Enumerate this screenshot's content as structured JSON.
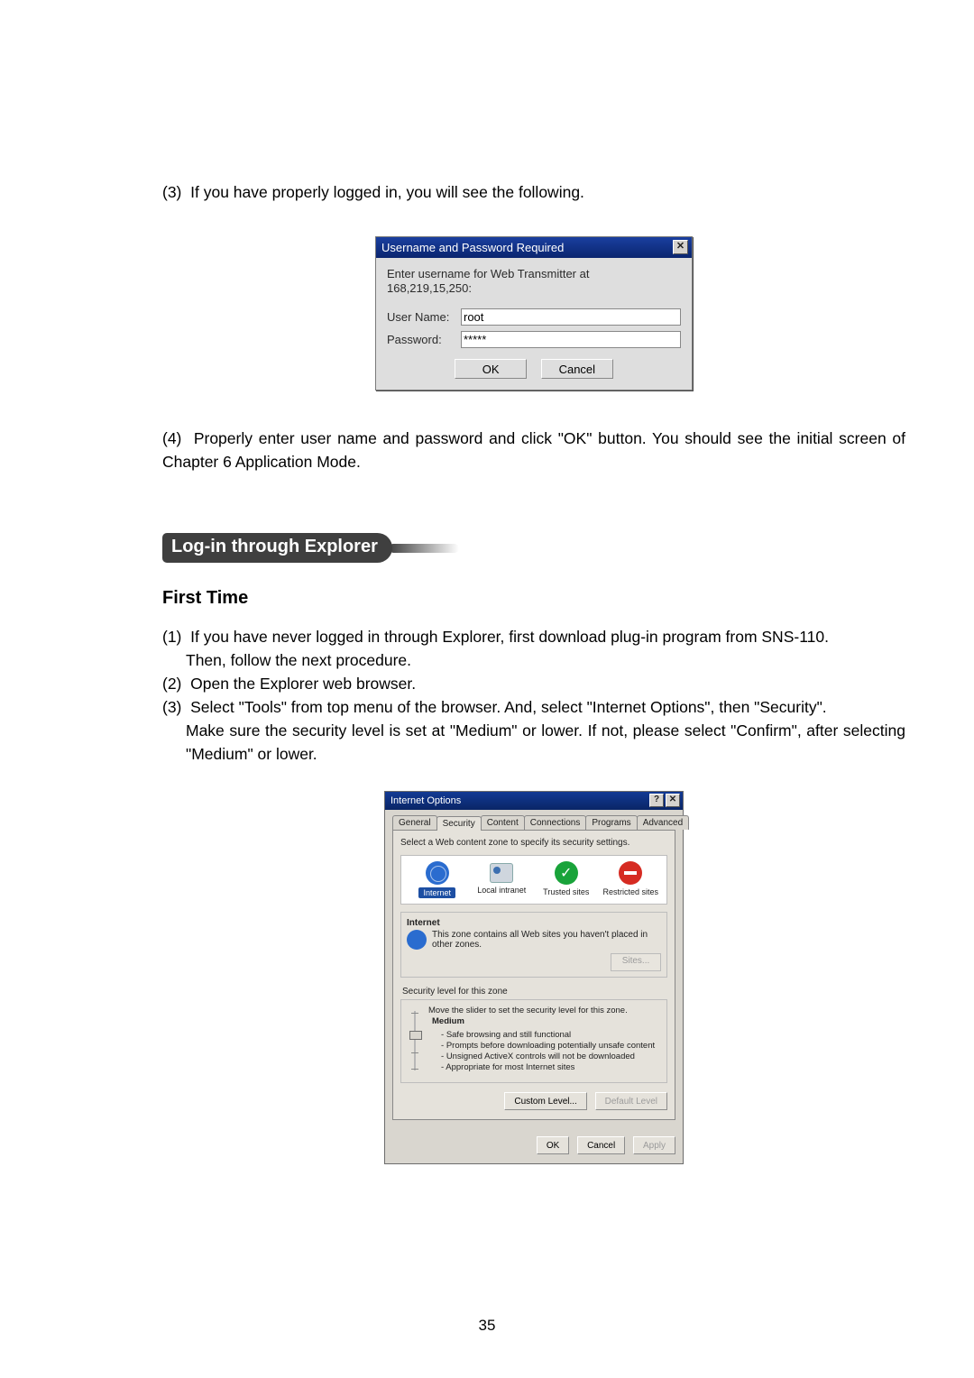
{
  "page_number": "35",
  "top_paragraph": {
    "n": "(3)",
    "text": "If you have properly logged in, you will see the following."
  },
  "login_dialog": {
    "title": "Username and Password Required",
    "message_l1": "Enter username for Web Transmitter at",
    "message_l2": "168,219,15,250:",
    "username_label": "User Name:",
    "username_value": "root",
    "password_label": "Password:",
    "password_value": "*****",
    "ok": "OK",
    "cancel": "Cancel"
  },
  "mid_paragraph": {
    "n": "(4)",
    "text": "Properly enter user name and password and click \"OK\" button.  You should see the initial screen of Chapter 6 Application Mode."
  },
  "section_heading": "Log-in through Explorer",
  "subheading": "First Time",
  "steps": [
    {
      "n": "(1)",
      "text": "If you have never logged in through Explorer, first download plug-in program from SNS-110.",
      "cont": "Then, follow the next procedure."
    },
    {
      "n": "(2)",
      "text": "Open the Explorer web browser."
    },
    {
      "n": "(3)",
      "text": "Select \"Tools\" from top menu of the browser.  And, select \"Internet Options\", then \"Security\".",
      "cont": "Make sure the security level is set at \"Medium\" or lower.  If not, please select \"Confirm\", after selecting \"Medium\" or lower."
    }
  ],
  "io_dialog": {
    "title": "Internet Options",
    "tabs": [
      "General",
      "Security",
      "Content",
      "Connections",
      "Programs",
      "Advanced"
    ],
    "active_tab_index": 1,
    "instruction": "Select a Web content zone to specify its security settings.",
    "zones": {
      "internet": "Internet",
      "local": "Local intranet",
      "trusted": "Trusted sites",
      "restricted": "Restricted sites"
    },
    "zone_box_head": "Internet",
    "zone_box_text": "This zone contains all Web sites you haven't placed in other zones.",
    "sites_btn": "Sites...",
    "sec_level_title": "Security level for this zone",
    "sec_level_instr": "Move the slider to set the security level for this zone.",
    "sec_level_name": "Medium",
    "sec_bullets": [
      "Safe browsing and still functional",
      "Prompts before downloading potentially unsafe content",
      "Unsigned ActiveX controls will not be downloaded",
      "Appropriate for most Internet sites"
    ],
    "custom_btn": "Custom Level...",
    "default_btn": "Default Level",
    "ok": "OK",
    "cancel": "Cancel",
    "apply": "Apply"
  }
}
